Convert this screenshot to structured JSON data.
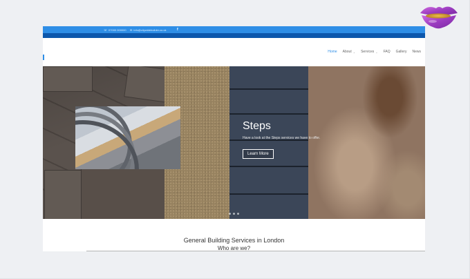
{
  "topbar": {
    "phone": "07000 000000",
    "email": "info@citywidebuilder.co.uk",
    "facebook": "f"
  },
  "nav": {
    "items": [
      {
        "label": "Home",
        "dropdown": false,
        "active": true
      },
      {
        "label": "About",
        "dropdown": true,
        "active": false
      },
      {
        "label": "Services",
        "dropdown": true,
        "active": false
      },
      {
        "label": "FAQ",
        "dropdown": false,
        "active": false
      },
      {
        "label": "Gallery",
        "dropdown": false,
        "active": false
      },
      {
        "label": "News",
        "dropdown": false,
        "active": false
      }
    ]
  },
  "hero": {
    "title": "Steps",
    "subtitle": "Have a look at the Steps services we have to offer.",
    "button": "Learn More"
  },
  "content": {
    "heading": "General Building Services in London",
    "subheading": "Who are we?"
  },
  "colors": {
    "accent": "#2e8ee6",
    "dark_band": "#0c57ac"
  },
  "icons": {
    "phone": "phone-icon",
    "email": "envelope-icon",
    "facebook": "facebook-icon",
    "caret": "chevron-down-icon"
  }
}
